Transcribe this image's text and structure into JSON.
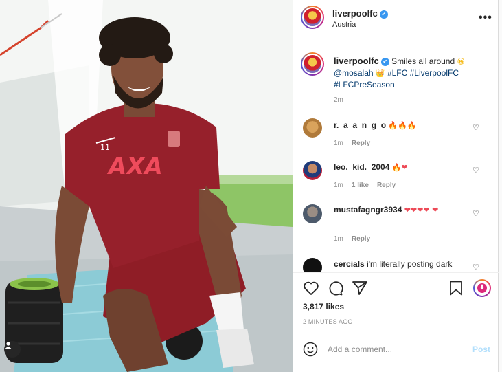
{
  "post": {
    "username": "liverpoolfc",
    "location": "Austria",
    "more_icon": "more-options-icon",
    "caption": {
      "username": "liverpoolfc",
      "text": "Smiles all around",
      "emoji": "😀",
      "mention": "@mosalah",
      "crown": "👑",
      "tags": "#LFC #LiverpoolFC #LFCPreSeason",
      "time": "2m"
    },
    "likes": "3,817 likes",
    "posted_ago": "2 MINUTES AGO"
  },
  "comments": [
    {
      "username": "r._a_a_n_g_o",
      "text": "",
      "emoji": "🔥🔥🔥",
      "time": "1m",
      "likes": "",
      "reply": "Reply"
    },
    {
      "username": "leo._kid._2004",
      "text": "",
      "emoji": "🔥❤",
      "time": "1m",
      "likes": "1 like",
      "reply": "Reply"
    },
    {
      "username": "mustafagngr3934",
      "text": "",
      "emoji": "❤❤❤❤ ❤",
      "time": "1m",
      "likes": "",
      "reply": "Reply"
    },
    {
      "username": "cercials",
      "text": "i'm literally posting dark",
      "emoji": "",
      "time": "",
      "likes": "",
      "reply": ""
    }
  ],
  "composer": {
    "placeholder": "Add a comment...",
    "post_label": "Post"
  },
  "colors": {
    "accent_link": "#00376b",
    "verified_blue": "#3897f0",
    "post_disabled": "#b2dffc",
    "like_red": "#ed4956"
  }
}
